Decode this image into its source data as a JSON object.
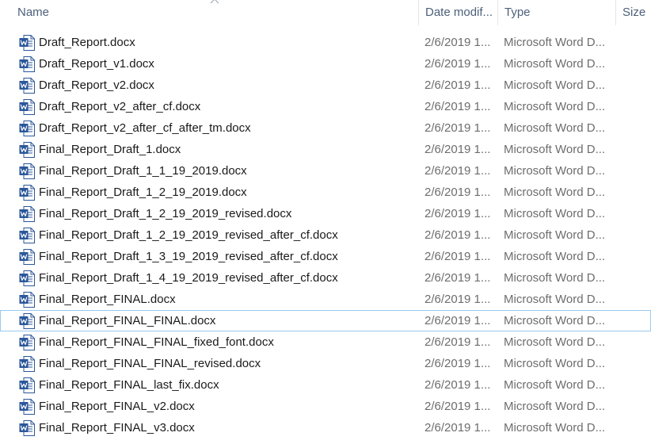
{
  "columns": {
    "name": "Name",
    "date_modified": "Date modif...",
    "type": "Type",
    "size": "Size"
  },
  "files": [
    {
      "name": "Draft_Report.docx",
      "date": "2/6/2019 1...",
      "type": "Microsoft Word D...",
      "icon": "word-doc-icon"
    },
    {
      "name": "Draft_Report_v1.docx",
      "date": "2/6/2019 1...",
      "type": "Microsoft Word D...",
      "icon": "word-doc-icon"
    },
    {
      "name": "Draft_Report_v2.docx",
      "date": "2/6/2019 1...",
      "type": "Microsoft Word D...",
      "icon": "word-doc-icon"
    },
    {
      "name": "Draft_Report_v2_after_cf.docx",
      "date": "2/6/2019 1...",
      "type": "Microsoft Word D...",
      "icon": "word-doc-icon"
    },
    {
      "name": "Draft_Report_v2_after_cf_after_tm.docx",
      "date": "2/6/2019 1...",
      "type": "Microsoft Word D...",
      "icon": "word-doc-icon"
    },
    {
      "name": "Final_Report_Draft_1.docx",
      "date": "2/6/2019 1...",
      "type": "Microsoft Word D...",
      "icon": "word-doc-icon"
    },
    {
      "name": "Final_Report_Draft_1_1_19_2019.docx",
      "date": "2/6/2019 1...",
      "type": "Microsoft Word D...",
      "icon": "word-doc-icon"
    },
    {
      "name": "Final_Report_Draft_1_2_19_2019.docx",
      "date": "2/6/2019 1...",
      "type": "Microsoft Word D...",
      "icon": "word-doc-icon"
    },
    {
      "name": "Final_Report_Draft_1_2_19_2019_revised.docx",
      "date": "2/6/2019 1...",
      "type": "Microsoft Word D...",
      "icon": "word-doc-icon"
    },
    {
      "name": "Final_Report_Draft_1_2_19_2019_revised_after_cf.docx",
      "date": "2/6/2019 1...",
      "type": "Microsoft Word D...",
      "icon": "word-doc-icon"
    },
    {
      "name": "Final_Report_Draft_1_3_19_2019_revised_after_cf.docx",
      "date": "2/6/2019 1...",
      "type": "Microsoft Word D...",
      "icon": "word-doc-icon"
    },
    {
      "name": "Final_Report_Draft_1_4_19_2019_revised_after_cf.docx",
      "date": "2/6/2019 1...",
      "type": "Microsoft Word D...",
      "icon": "word-doc-icon"
    },
    {
      "name": "Final_Report_FINAL.docx",
      "date": "2/6/2019 1...",
      "type": "Microsoft Word D...",
      "icon": "word-doc-icon"
    },
    {
      "name": "Final_Report_FINAL_FINAL.docx",
      "date": "2/6/2019 1...",
      "type": "Microsoft Word D...",
      "icon": "word-doc-icon",
      "focused": true
    },
    {
      "name": "Final_Report_FINAL_FINAL_fixed_font.docx",
      "date": "2/6/2019 1...",
      "type": "Microsoft Word D...",
      "icon": "word-doc-icon"
    },
    {
      "name": "Final_Report_FINAL_FINAL_revised.docx",
      "date": "2/6/2019 1...",
      "type": "Microsoft Word D...",
      "icon": "word-doc-icon"
    },
    {
      "name": "Final_Report_FINAL_last_fix.docx",
      "date": "2/6/2019 1...",
      "type": "Microsoft Word D...",
      "icon": "word-doc-icon"
    },
    {
      "name": "Final_Report_FINAL_v2.docx",
      "date": "2/6/2019 1...",
      "type": "Microsoft Word D...",
      "icon": "word-doc-icon"
    },
    {
      "name": "Final_Report_FINAL_v3.docx",
      "date": "2/6/2019 1...",
      "type": "Microsoft Word D...",
      "icon": "word-doc-icon"
    }
  ],
  "colors": {
    "header_text": "#4c607a",
    "name_text": "#1a1a1a",
    "detail_text": "#6d6d6d",
    "focus_border": "#99c9ef",
    "word_blue": "#2b579a"
  }
}
